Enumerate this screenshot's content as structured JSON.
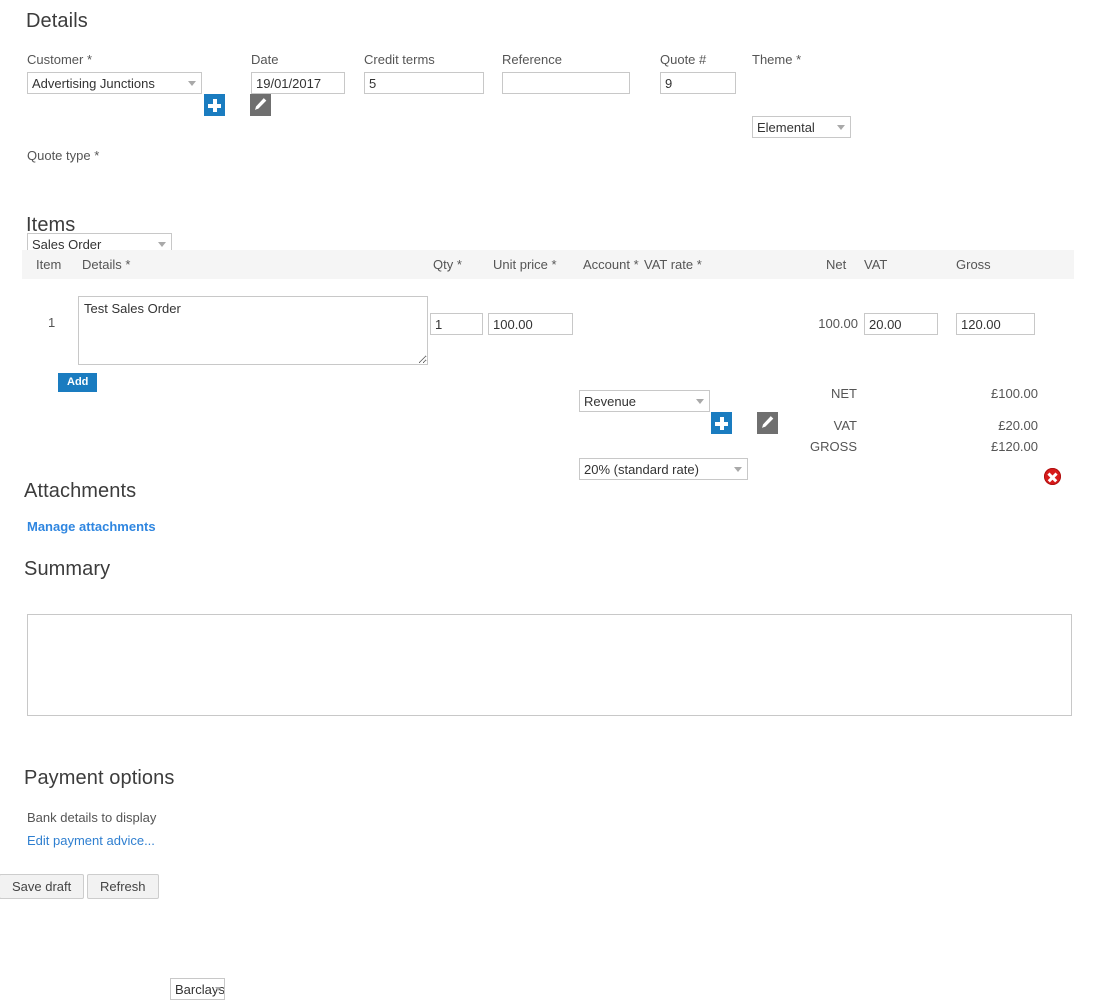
{
  "details": {
    "heading": "Details",
    "customer": {
      "label": "Customer *",
      "value": "Advertising Junctions",
      "add_title": "Add customer",
      "edit_title": "Edit customer"
    },
    "date": {
      "label": "Date",
      "value": "19/01/2017"
    },
    "credit_terms": {
      "label": "Credit terms",
      "value": "5"
    },
    "reference": {
      "label": "Reference",
      "value": ""
    },
    "quote_number": {
      "label": "Quote #",
      "value": "9"
    },
    "theme": {
      "label": "Theme *",
      "value": "Elemental"
    },
    "quote_type": {
      "label": "Quote type   *",
      "value": "Sales Order"
    }
  },
  "items": {
    "heading": "Items",
    "columns": {
      "item": "Item",
      "details": "Details *",
      "qty": "Qty *",
      "unit_price": "Unit price *",
      "account": "Account *",
      "vat_rate": "VAT rate *",
      "net": "Net",
      "vat": "VAT",
      "gross": "Gross"
    },
    "rows": [
      {
        "index": "1",
        "details": "Test Sales Order",
        "qty": "1",
        "unit_price": "100.00",
        "account": "Revenue",
        "vat_rate": "20% (standard rate)",
        "net": "100.00",
        "vat": "20.00",
        "gross": "120.00"
      }
    ],
    "add_label": "Add",
    "totals": [
      {
        "label": "NET",
        "value": "£100.00"
      },
      {
        "label": "VAT",
        "value": "£20.00"
      },
      {
        "label": "GROSS",
        "value": "£120.00"
      }
    ]
  },
  "attachments": {
    "heading": "Attachments",
    "manage_link": "Manage attachments"
  },
  "summary": {
    "heading": "Summary",
    "value": ""
  },
  "payment_options": {
    "heading": "Payment options",
    "bank_label": "Bank details to display",
    "bank_value": "Barclays",
    "edit_advice_link": "Edit payment advice..."
  },
  "footer": {
    "save_draft": "Save draft",
    "refresh": "Refresh"
  },
  "colors": {
    "accent_blue": "#1a7cc0",
    "link_blue": "#2f7fd0",
    "delete_red": "#d71b1b",
    "header_grey": "#f5f5f5"
  }
}
